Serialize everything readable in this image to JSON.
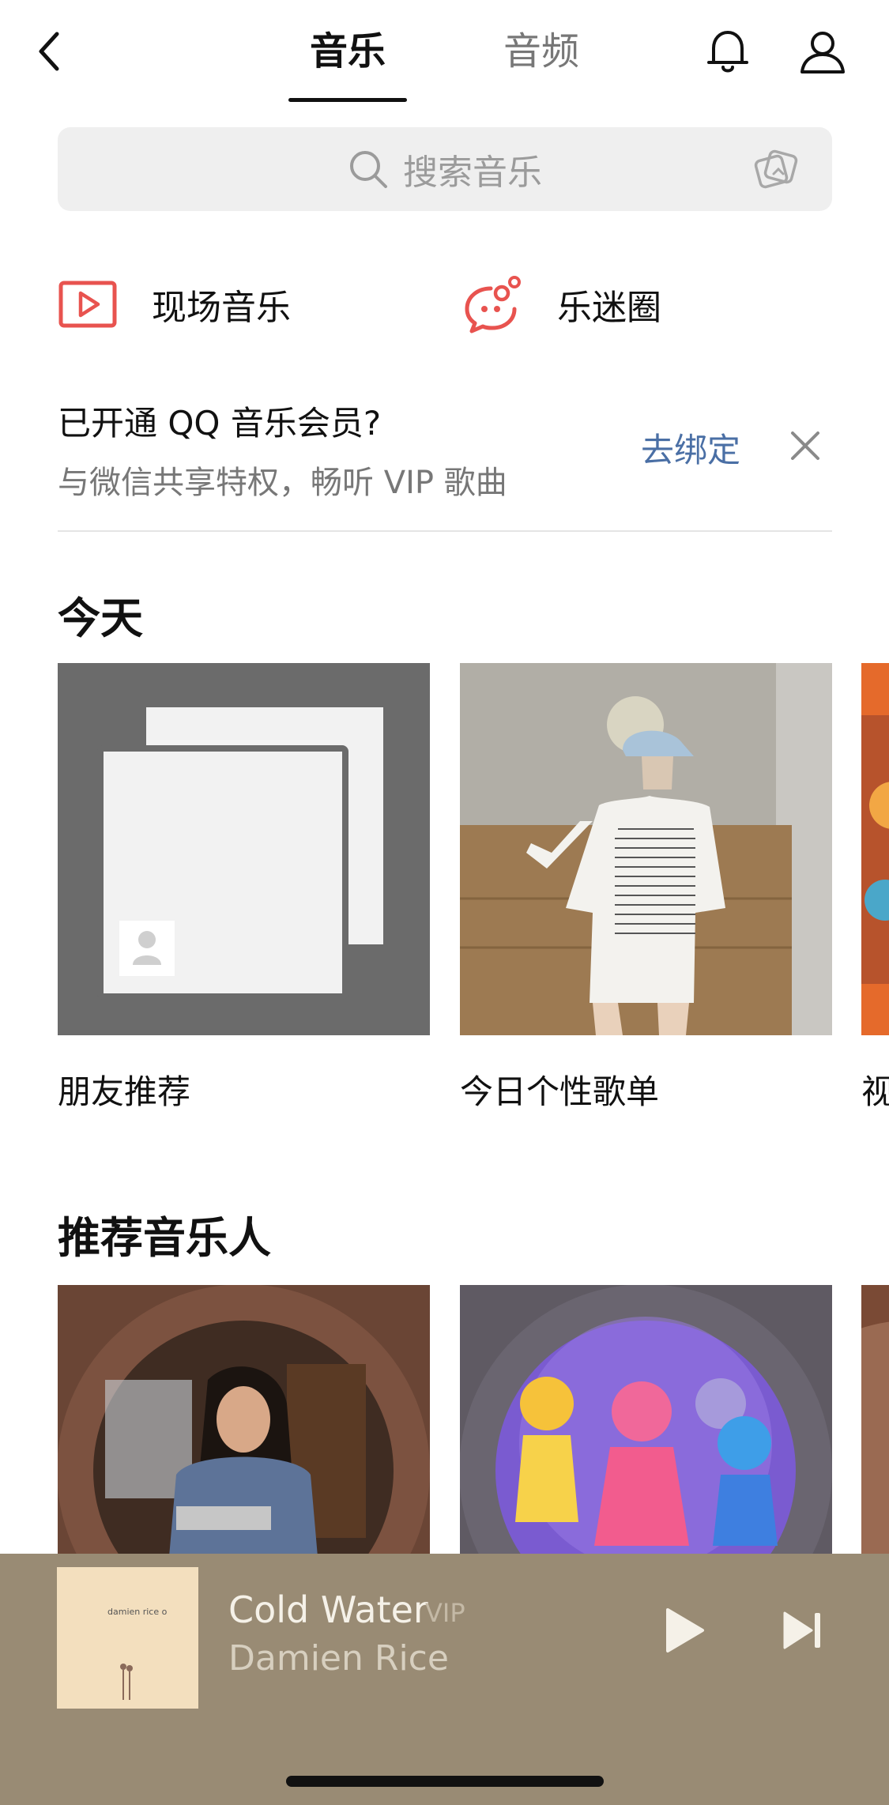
{
  "header": {
    "tabs": [
      {
        "label": "音乐",
        "active": true
      },
      {
        "label": "音频",
        "active": false
      }
    ],
    "icons": [
      "back-icon",
      "bell-icon",
      "user-icon"
    ]
  },
  "search": {
    "placeholder": "搜索音乐",
    "icons": [
      "search-icon",
      "scan-icon"
    ]
  },
  "quick_links": [
    {
      "label": "现场音乐",
      "icon": "video-play-icon",
      "color": "#e8534f"
    },
    {
      "label": "乐迷圈",
      "icon": "chat-bubble-icon",
      "color": "#e8534f"
    }
  ],
  "banner": {
    "title": "已开通 QQ 音乐会员?",
    "subtitle": "与微信共享特权，畅听 VIP 歌曲",
    "action": "去绑定",
    "action_color": "#4a6fa5"
  },
  "today": {
    "title": "今天",
    "cards": [
      {
        "label": "朋友推荐"
      },
      {
        "label": "今日个性歌单"
      },
      {
        "label": "视"
      }
    ]
  },
  "artists": {
    "title": "推荐音乐人"
  },
  "player": {
    "song": "Cold Water",
    "badge": "VIP",
    "artist": "Damien Rice",
    "cover_text": "damien rice  o",
    "background": "#998b74"
  }
}
